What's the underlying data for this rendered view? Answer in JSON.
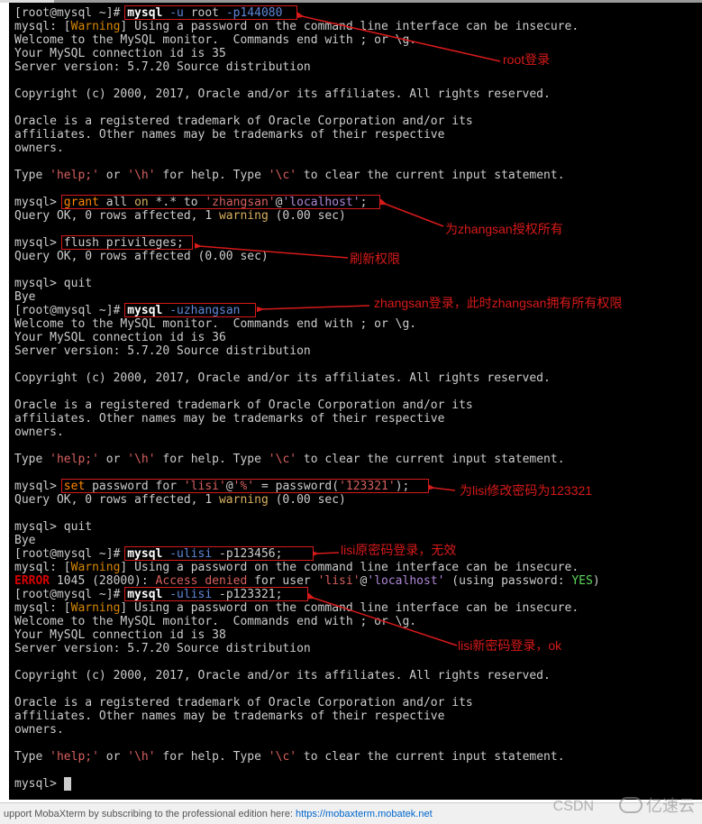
{
  "t": {
    "l1_prompt": "[root@mysql ~]# ",
    "l1_cmd": "mysql ",
    "l1_u": "-u ",
    "l1_root": "root ",
    "l1_p": "-p144080",
    "l2_a": "mysql: [",
    "l2_w": "Warning",
    "l2_b": "] Using a password on the command line interface can be insecure.",
    "l3": "Welcome to the MySQL monitor.  Commands end with ; or \\g.",
    "l4": "Your MySQL connection id is 35",
    "l5": "Server version: 5.7.20 Source distribution",
    "l7": "Copyright (c) 2000, 2017, Oracle and/or its affiliates. All rights reserved.",
    "l9": "Oracle is a registered trademark of Oracle Corporation and/or its",
    "l10": "affiliates. Other names may be trademarks of their respective",
    "l11": "owners.",
    "l13_a": "Type ",
    "l13_b": "'help;'",
    "l13_c": " or ",
    "l13_d": "'\\h'",
    "l13_e": " for help. Type ",
    "l13_f": "'\\c'",
    "l13_g": " to clear the current input statement.",
    "l15_a": "mysql> ",
    "l15_b": "grant",
    "l15_c": " all ",
    "l15_d": "on",
    "l15_e": " *.* to ",
    "l15_f": "'zhangsan'",
    "l15_g": "@",
    "l15_h": "'localhost'",
    "l15_i": ";",
    "l16_a": "Query OK, 0 rows affected, 1 ",
    "l16_b": "warning",
    "l16_c": " (0.00 sec)",
    "l18_b": "flush privileges;",
    "l19": "Query OK, 0 rows affected (0.00 sec)",
    "l21": "mysql> quit",
    "l22": "Bye",
    "l23_cmd": "mysql ",
    "l23_u": "-uzhangsan",
    "l25": "Your MySQL connection id is 36",
    "l33_b": "set",
    "l33_c": " password for ",
    "l33_d": "'lisi'",
    "l33_e": "@",
    "l33_f": "'%'",
    "l33_g": " = password(",
    "l33_h": "'123321'",
    "l33_i": ");",
    "l38_u": "-ulisi",
    "l38_p": " -p123456;",
    "l40_a": "ERROR",
    "l40_b": " 1045 (28000): ",
    "l40_c": "Access denied",
    "l40_d": " for user ",
    "l40_e": "'lisi'",
    "l40_f": "@",
    "l40_g": "'localhost'",
    "l40_h": " (using password: ",
    "l40_i": "YES",
    "l40_j": ")",
    "l41_p": " -p123321;",
    "l44": "Your MySQL connection id is 38",
    "l53": "mysql> "
  },
  "ann": {
    "a1": "root登录",
    "a2": "为zhangsan授权所有",
    "a3": "刷新权限",
    "a4": "zhangsan登录，此时zhangsan拥有所有权限",
    "a5": "为lisi修改密码为123321",
    "a6": "lisi原密码登录，无效",
    "a7": "lisi新密码登录，ok"
  },
  "footer": {
    "text": "upport MobaXterm by subscribing to the professional edition here:",
    "link": "https://mobaxterm.mobatek.net"
  },
  "wm1": "CSDN",
  "wm2": "亿速云"
}
